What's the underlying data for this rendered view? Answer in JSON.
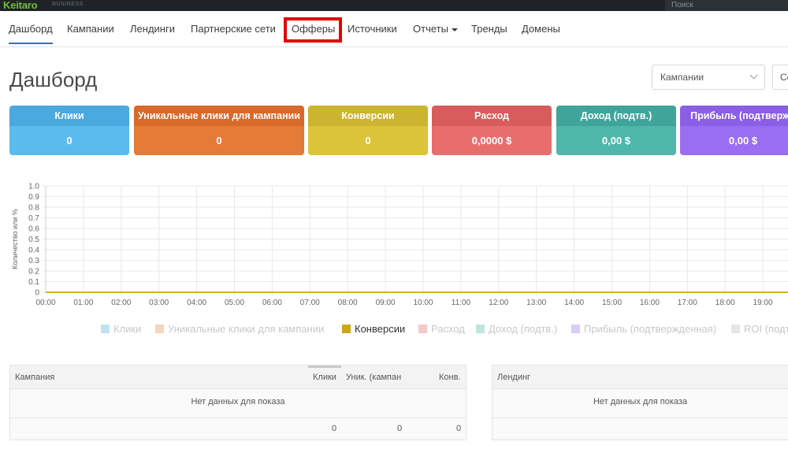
{
  "app": {
    "name": "Keitaro",
    "edition": "BUSINESS",
    "search_placeholder": "Поиск"
  },
  "nav": {
    "items": [
      {
        "label": "Дашборд"
      },
      {
        "label": "Кампании"
      },
      {
        "label": "Лендинги"
      },
      {
        "label": "Партнерские сети"
      },
      {
        "label": "Офферы"
      },
      {
        "label": "Источники"
      },
      {
        "label": "Отчеты"
      },
      {
        "label": "Тренды"
      },
      {
        "label": "Домены"
      }
    ]
  },
  "header": {
    "title": "Дашборд",
    "filter_select": "Кампании",
    "second_select": "Се"
  },
  "cards": [
    {
      "label": "Клики",
      "value": "0",
      "head": "#4aa9de",
      "body": "#5bbbef"
    },
    {
      "label": "Уникальные клики для кампании",
      "value": "0",
      "head": "#d9692b",
      "body": "#e67a37"
    },
    {
      "label": "Конверсии",
      "value": "0",
      "head": "#cbb42f",
      "body": "#dcc43a"
    },
    {
      "label": "Расход",
      "value": "0,0000 $",
      "head": "#d95c5c",
      "body": "#e86e6e"
    },
    {
      "label": "Доход (подтв.)",
      "value": "0,00 $",
      "head": "#3fa59a",
      "body": "#4fb6aa"
    },
    {
      "label": "Прибыль (подтвержд",
      "value": "0,00 $",
      "head": "#8b5ee6",
      "body": "#9a6ef2"
    }
  ],
  "chart_data": {
    "type": "line",
    "ylabel": "Количество или %",
    "ylim": [
      0,
      1.0
    ],
    "yticks": [
      "0",
      "0.1",
      "0.2",
      "0.3",
      "0.4",
      "0.5",
      "0.6",
      "0.7",
      "0.8",
      "0.9",
      "1.0"
    ],
    "x": [
      "00:00",
      "01:00",
      "02:00",
      "03:00",
      "04:00",
      "05:00",
      "06:00",
      "07:00",
      "08:00",
      "09:00",
      "10:00",
      "11:00",
      "12:00",
      "13:00",
      "14:00",
      "15:00",
      "16:00",
      "17:00",
      "18:00",
      "19:00"
    ],
    "series": [
      {
        "name": "Конверсии",
        "values": [
          0,
          0,
          0,
          0,
          0,
          0,
          0,
          0,
          0,
          0,
          0,
          0,
          0,
          0,
          0,
          0,
          0,
          0,
          0,
          0
        ]
      }
    ],
    "grid": true,
    "legend": "bottom"
  },
  "legend": [
    {
      "label": "Клики",
      "color": "#bfe3f5",
      "active": false
    },
    {
      "label": "Уникальные клики для кампании",
      "color": "#f6d5bd",
      "active": false
    },
    {
      "label": "Конверсии",
      "color": "#c9a71b",
      "active": true
    },
    {
      "label": "Расход",
      "color": "#f6c8c8",
      "active": false
    },
    {
      "label": "Доход (подтв.)",
      "color": "#bde6df",
      "active": false
    },
    {
      "label": "Прибыль (подтвержденная)",
      "color": "#d9ccf7",
      "active": false
    },
    {
      "label": "ROI (подт",
      "color": "#e6e6e6",
      "active": false
    }
  ],
  "tables": {
    "campaigns": {
      "columns": [
        "Кампания",
        "Клики",
        "Уник. (кампан",
        "Конв."
      ],
      "empty": "Нет данных для показа",
      "totals": [
        "0",
        "0",
        "0"
      ]
    },
    "landings": {
      "columns": [
        "Лендинг"
      ],
      "empty": "Нет данных для показа"
    }
  }
}
